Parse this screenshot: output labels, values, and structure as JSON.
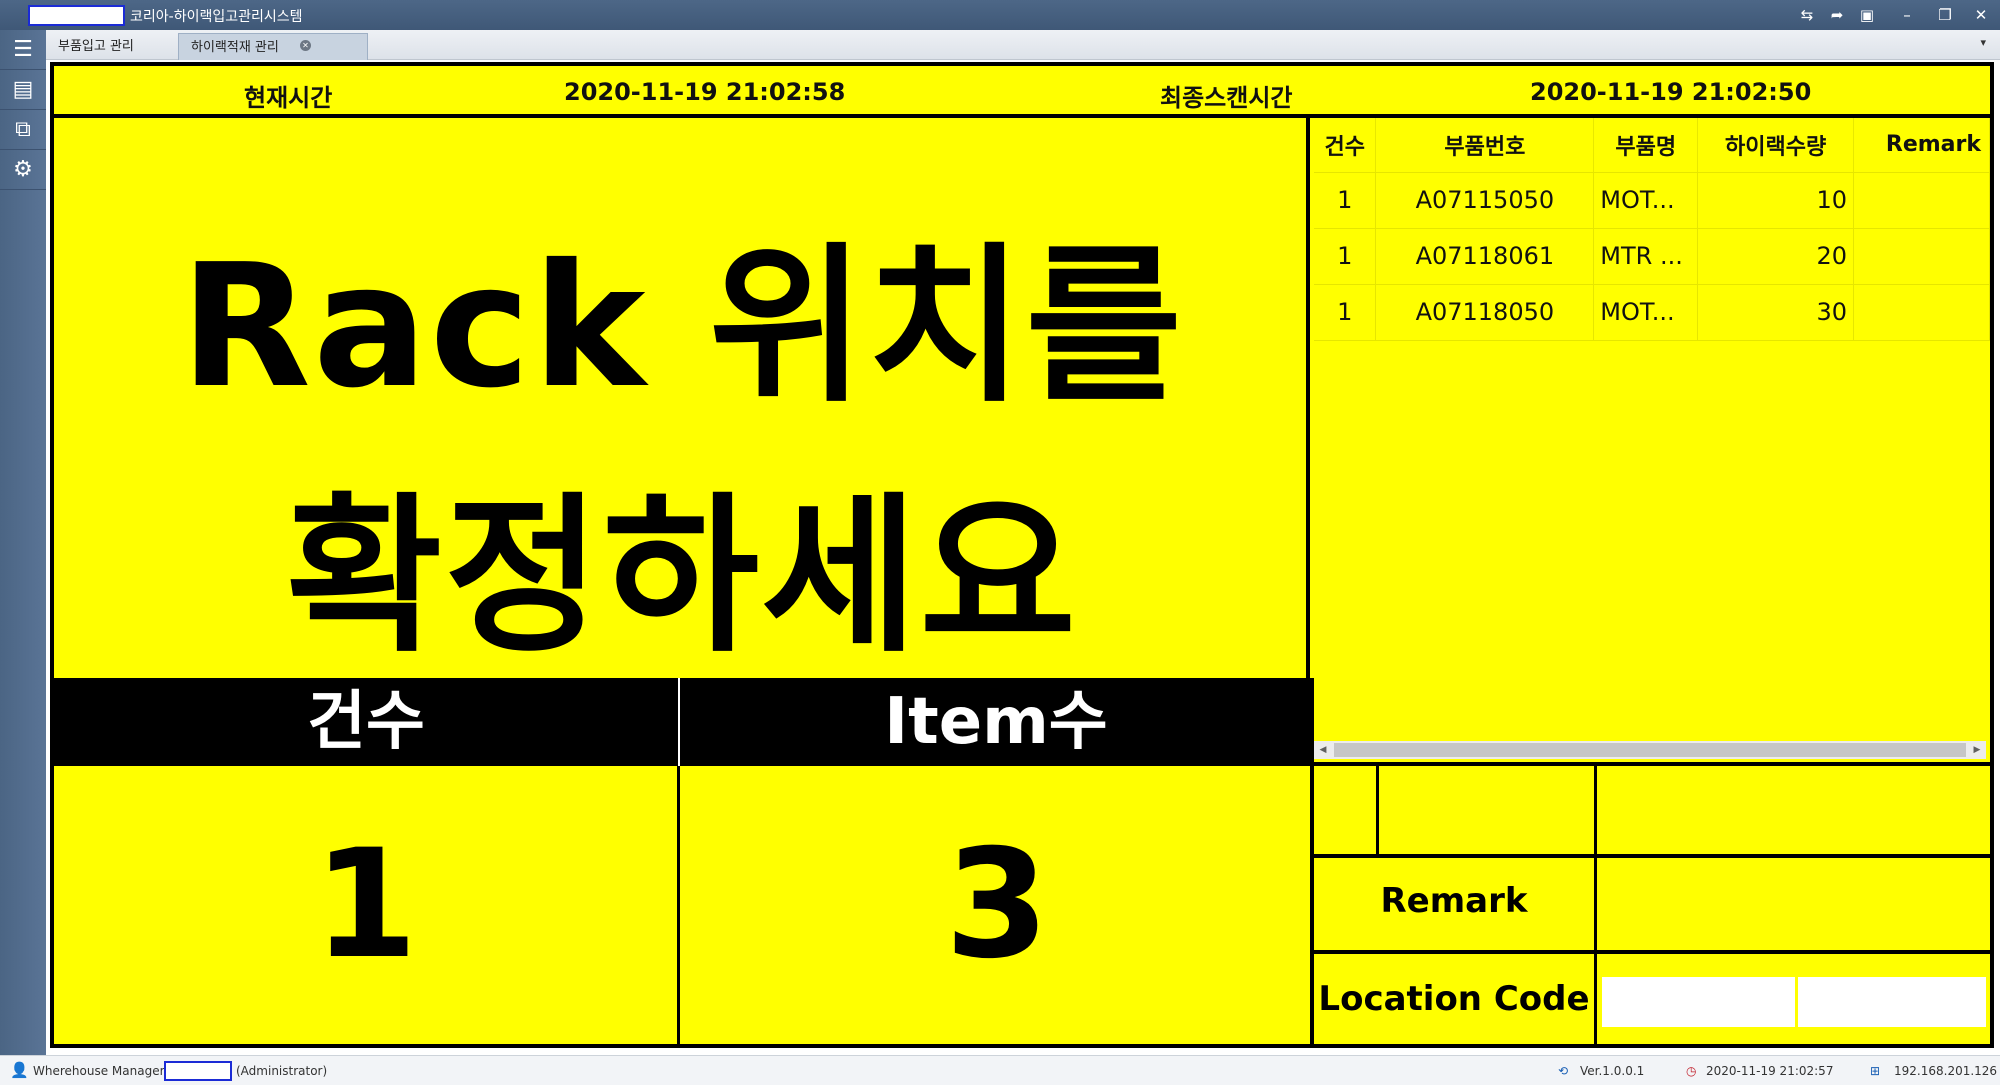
{
  "app": {
    "title": "코리아-하이랙입고관리시스템",
    "titlebar_icons": [
      "user-swap-icon",
      "share-icon",
      "window-icon",
      "minimize-icon",
      "restore-icon",
      "close-icon"
    ]
  },
  "tabs": [
    {
      "label": "부품입고 관리"
    },
    {
      "label": "하이랙적재 관리",
      "active": true
    }
  ],
  "sidebar": {
    "items": [
      {
        "icon": "menu-icon",
        "glyph": "☰"
      },
      {
        "icon": "save-icon",
        "glyph": "💾"
      },
      {
        "icon": "copy-icon",
        "glyph": "⧉"
      },
      {
        "icon": "gear-icon",
        "glyph": "⚙"
      }
    ]
  },
  "header": {
    "current_time_label": "현재시간",
    "current_time": "2020-11-19 21:02:58",
    "last_scan_label": "최종스캔시간",
    "last_scan_time": "2020-11-19 21:02:50"
  },
  "message": {
    "line1": "Rack 위치를",
    "line2": "확정하세요"
  },
  "counts": {
    "count_label": "건수",
    "item_label": "Item수",
    "count_value": "1",
    "item_value": "3"
  },
  "grid": {
    "columns": [
      "건수",
      "부품번호",
      "부품명",
      "하이랙수량",
      "Remark"
    ],
    "rows": [
      {
        "count": "1",
        "part_no": "A07115050",
        "part_name": "MOT...",
        "qty": "10",
        "remark": ""
      },
      {
        "count": "1",
        "part_no": "A07118061",
        "part_name": "MTR ...",
        "qty": "20",
        "remark": ""
      },
      {
        "count": "1",
        "part_no": "A07118050",
        "part_name": "MOT...",
        "qty": "30",
        "remark": ""
      }
    ]
  },
  "info": {
    "remark_label": "Remark",
    "location_label": "Location Code",
    "location_value1": "",
    "location_value2": ""
  },
  "status": {
    "user_prefix": "Wherehouse Manager",
    "user_role": "(Administrator)",
    "version": "Ver.1.0.0.1",
    "datetime": "2020-11-19 21:02:57",
    "ip": "192.168.201.126"
  },
  "colors": {
    "panel_background": "#ffff00",
    "titlebar": "#4d6787",
    "accent_box": "#1b2bd6"
  }
}
